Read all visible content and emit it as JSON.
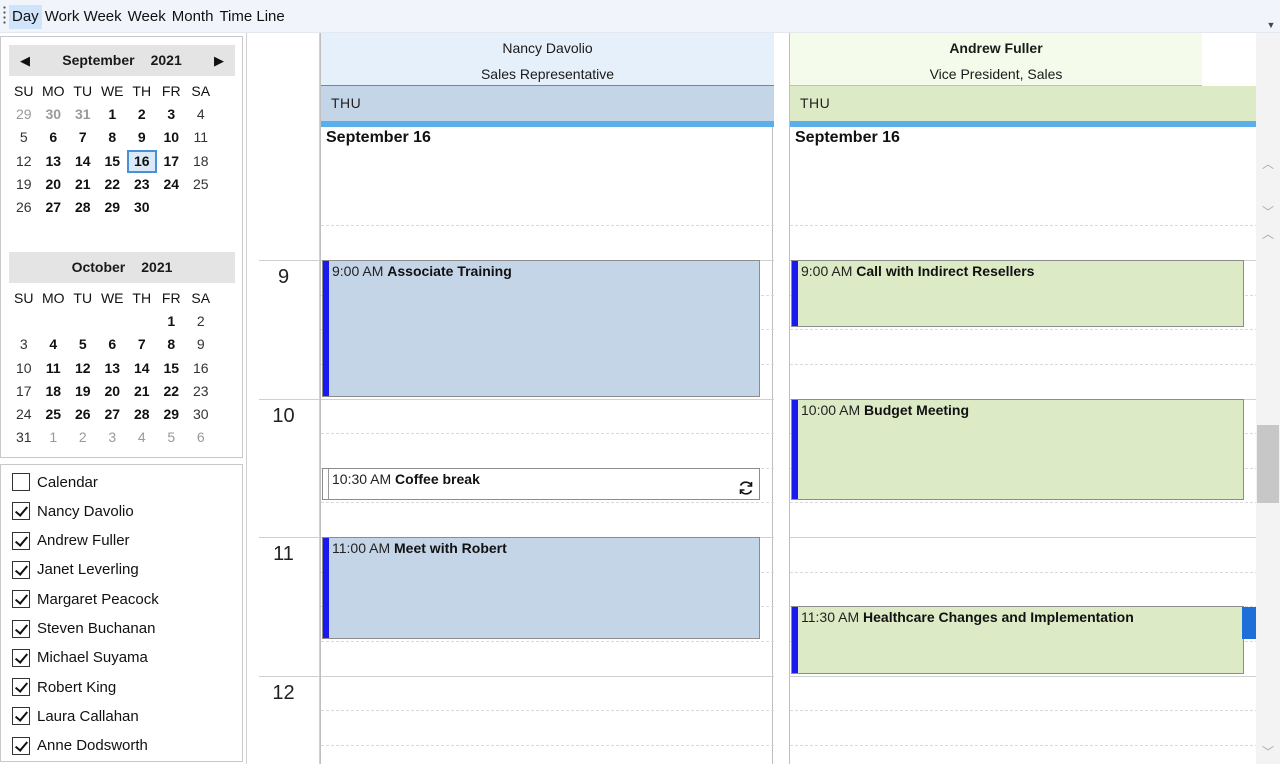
{
  "toolbar": {
    "views": [
      "Day",
      "Work Week",
      "Week",
      "Month",
      "Time Line"
    ],
    "active_view": "Day"
  },
  "mini_calendar": {
    "dow": [
      "SU",
      "MO",
      "TU",
      "WE",
      "TH",
      "FR",
      "SA"
    ],
    "months": [
      {
        "month": "September",
        "year": "2021",
        "weeks": [
          [
            {
              "d": "29",
              "o": true
            },
            {
              "d": "30",
              "o": true,
              "b": true
            },
            {
              "d": "31",
              "o": true,
              "b": true
            },
            {
              "d": "1",
              "b": true
            },
            {
              "d": "2",
              "b": true
            },
            {
              "d": "3",
              "b": true
            },
            {
              "d": "4"
            }
          ],
          [
            {
              "d": "5"
            },
            {
              "d": "6",
              "b": true
            },
            {
              "d": "7",
              "b": true
            },
            {
              "d": "8",
              "b": true
            },
            {
              "d": "9",
              "b": true
            },
            {
              "d": "10",
              "b": true
            },
            {
              "d": "11"
            }
          ],
          [
            {
              "d": "12"
            },
            {
              "d": "13",
              "b": true
            },
            {
              "d": "14",
              "b": true
            },
            {
              "d": "15",
              "b": true
            },
            {
              "d": "16",
              "b": true,
              "s": true
            },
            {
              "d": "17",
              "b": true
            },
            {
              "d": "18"
            }
          ],
          [
            {
              "d": "19"
            },
            {
              "d": "20",
              "b": true
            },
            {
              "d": "21",
              "b": true
            },
            {
              "d": "22",
              "b": true
            },
            {
              "d": "23",
              "b": true
            },
            {
              "d": "24",
              "b": true
            },
            {
              "d": "25"
            }
          ],
          [
            {
              "d": "26"
            },
            {
              "d": "27",
              "b": true
            },
            {
              "d": "28",
              "b": true
            },
            {
              "d": "29",
              "b": true
            },
            {
              "d": "30",
              "b": true
            },
            {
              "d": ""
            },
            {
              "d": ""
            }
          ]
        ]
      },
      {
        "month": "October",
        "year": "2021",
        "weeks": [
          [
            {
              "d": ""
            },
            {
              "d": ""
            },
            {
              "d": ""
            },
            {
              "d": ""
            },
            {
              "d": ""
            },
            {
              "d": "1",
              "b": true
            },
            {
              "d": "2"
            }
          ],
          [
            {
              "d": "3"
            },
            {
              "d": "4",
              "b": true
            },
            {
              "d": "5",
              "b": true
            },
            {
              "d": "6",
              "b": true
            },
            {
              "d": "7",
              "b": true
            },
            {
              "d": "8",
              "b": true
            },
            {
              "d": "9"
            }
          ],
          [
            {
              "d": "10"
            },
            {
              "d": "11",
              "b": true
            },
            {
              "d": "12",
              "b": true
            },
            {
              "d": "13",
              "b": true
            },
            {
              "d": "14",
              "b": true
            },
            {
              "d": "15",
              "b": true
            },
            {
              "d": "16"
            }
          ],
          [
            {
              "d": "17"
            },
            {
              "d": "18",
              "b": true
            },
            {
              "d": "19",
              "b": true
            },
            {
              "d": "20",
              "b": true
            },
            {
              "d": "21",
              "b": true
            },
            {
              "d": "22",
              "b": true
            },
            {
              "d": "23"
            }
          ],
          [
            {
              "d": "24"
            },
            {
              "d": "25",
              "b": true
            },
            {
              "d": "26",
              "b": true
            },
            {
              "d": "27",
              "b": true
            },
            {
              "d": "28",
              "b": true
            },
            {
              "d": "29",
              "b": true
            },
            {
              "d": "30"
            }
          ],
          [
            {
              "d": "31"
            },
            {
              "d": "1",
              "o": true
            },
            {
              "d": "2",
              "o": true
            },
            {
              "d": "3",
              "o": true
            },
            {
              "d": "4",
              "o": true
            },
            {
              "d": "5",
              "o": true
            },
            {
              "d": "6",
              "o": true
            }
          ]
        ]
      }
    ]
  },
  "resources_list": [
    {
      "label": "Calendar",
      "checked": false
    },
    {
      "label": "Nancy Davolio",
      "checked": true
    },
    {
      "label": "Andrew Fuller",
      "checked": true
    },
    {
      "label": "Janet Leverling",
      "checked": true
    },
    {
      "label": "Margaret Peacock",
      "checked": true
    },
    {
      "label": "Steven Buchanan",
      "checked": true
    },
    {
      "label": "Michael Suyama",
      "checked": true
    },
    {
      "label": "Robert King",
      "checked": true
    },
    {
      "label": "Laura Callahan",
      "checked": true
    },
    {
      "label": "Anne Dodsworth",
      "checked": true
    }
  ],
  "scheduler": {
    "hours": [
      "9",
      "10",
      "11",
      "12"
    ],
    "nav": {
      "next": ">",
      "last": ">>|"
    },
    "resources": [
      {
        "name": "Nancy Davolio",
        "role": "Sales Representative",
        "header_bg": "#e6f0fb",
        "day_bg": "#c5d5e8",
        "appt_bg": "#c5d5e8",
        "bar_color": "#1a1aee",
        "day": "THU",
        "date": "September 16",
        "appointments": [
          {
            "time": "9:00 AM",
            "subject": "Associate Training",
            "start": 9.0,
            "end": 10.0
          },
          {
            "time": "10:30 AM",
            "subject": "Coffee break",
            "start": 10.5,
            "end": 10.75,
            "recurring": true
          },
          {
            "time": "11:00 AM",
            "subject": "Meet with Robert",
            "start": 11.0,
            "end": 11.75
          }
        ]
      },
      {
        "name": "Andrew Fuller",
        "role": "Vice President, Sales",
        "header_bg": "#f5fbea",
        "day_bg": "#dcebc6",
        "appt_bg": "#dcebc6",
        "bar_color": "#1a1aee",
        "day": "THU",
        "date": "September 16",
        "appointments": [
          {
            "time": "9:00 AM",
            "subject": "Call with Indirect Resellers",
            "start": 9.0,
            "end": 9.5
          },
          {
            "time": "10:00 AM",
            "subject": "Budget Meeting",
            "start": 10.0,
            "end": 10.75
          },
          {
            "time": "11:30 AM",
            "subject": "Healthcare Changes and Implementation",
            "start": 11.5,
            "end": 12.0
          }
        ]
      }
    ]
  }
}
